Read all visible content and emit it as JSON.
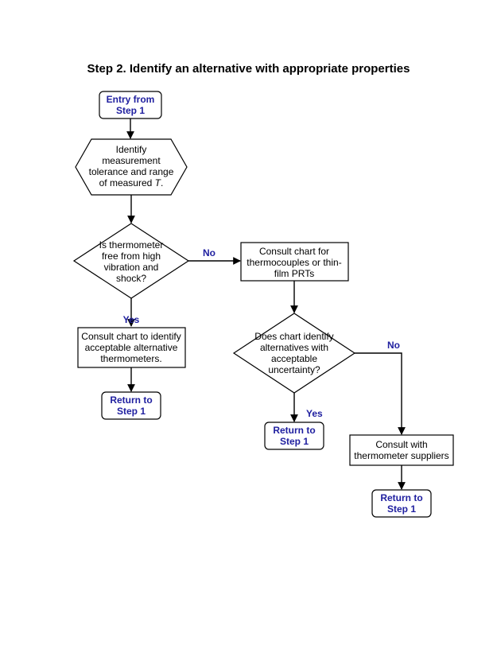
{
  "title": "Step 2.  Identify an alternative with appropriate properties",
  "nodes": {
    "entry": {
      "line1": "Entry from",
      "line2": "Step 1"
    },
    "identify": {
      "line1": "Identify",
      "line2": "measurement",
      "line3": "tolerance and range",
      "line4a": "of measured ",
      "line4b": "T",
      "line4c": "."
    },
    "vibration": {
      "line1": "Is thermometer",
      "line2": "free from high",
      "line3": "vibration and",
      "line4": "shock?"
    },
    "consult_chart_alt": {
      "line1": "Consult chart to identify",
      "line2": "acceptable alternative",
      "line3": "thermometers."
    },
    "return1": {
      "line1": "Return to",
      "line2": "Step 1"
    },
    "consult_tc": {
      "line1": "Consult chart for",
      "line2": "thermocouples or thin-",
      "line3": "film PRTs"
    },
    "chart_identify": {
      "line1": "Does chart identify",
      "line2": "alternatives with",
      "line3": "acceptable",
      "line4": "uncertainty?"
    },
    "return2": {
      "line1": "Return to",
      "line2": "Step 1"
    },
    "consult_suppliers": {
      "line1": "Consult with",
      "line2": "thermometer suppliers"
    },
    "return3": {
      "line1": "Return to",
      "line2": "Step 1"
    }
  },
  "edges": {
    "no1": "No",
    "yes1": "Yes",
    "yes2": "Yes",
    "no2": "No"
  }
}
